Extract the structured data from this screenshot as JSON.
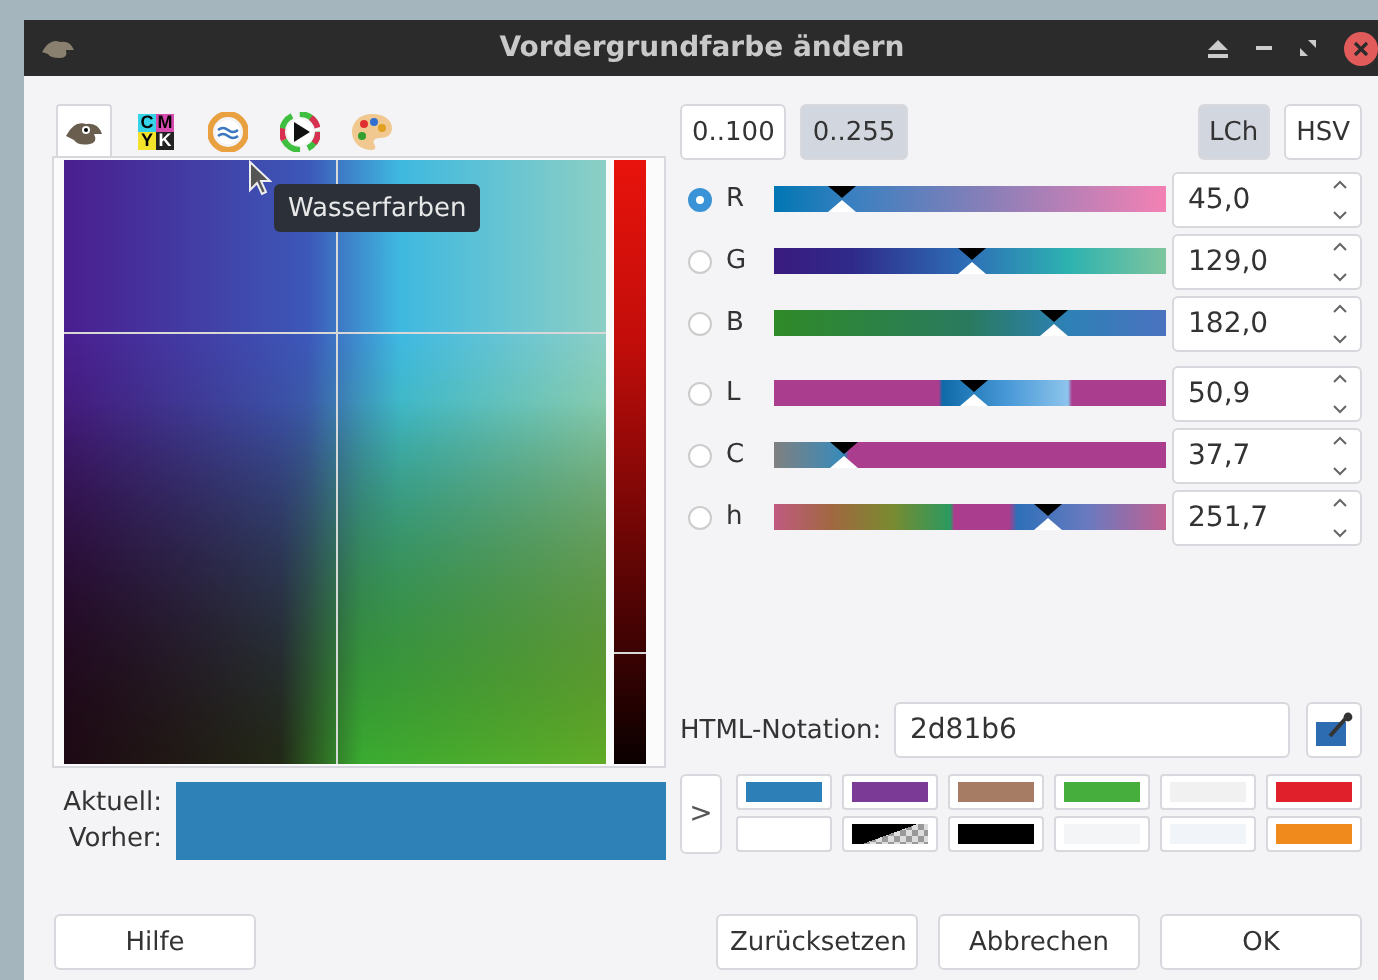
{
  "window": {
    "title": "Vordergrundfarbe ändern"
  },
  "selector_tabs": [
    {
      "kind": "gimp",
      "selected": true
    },
    {
      "kind": "cmyk",
      "selected": false,
      "letters": [
        "C",
        "M",
        "Y",
        "K"
      ]
    },
    {
      "kind": "water",
      "selected": false
    },
    {
      "kind": "wheel",
      "selected": false
    },
    {
      "kind": "palette",
      "selected": false
    }
  ],
  "tooltip": "Wasserfarben",
  "range_buttons": [
    {
      "label": "0..100",
      "selected": false
    },
    {
      "label": "0..255",
      "selected": true
    }
  ],
  "model_buttons": [
    {
      "label": "LCh",
      "selected": true
    },
    {
      "label": "HSV",
      "selected": false
    }
  ],
  "rgb_channels": [
    {
      "label": "R",
      "selected": true,
      "level": 0.176,
      "value": "45,0"
    },
    {
      "label": "G",
      "selected": false,
      "level": 0.506,
      "value": "129,0"
    },
    {
      "label": "B",
      "selected": false,
      "level": 0.714,
      "value": "182,0"
    }
  ],
  "lch_channels": [
    {
      "label": "L",
      "selected": false,
      "level": 0.509,
      "value": "50,9"
    },
    {
      "label": "C",
      "selected": false,
      "level": 0.18,
      "value": "37,7"
    },
    {
      "label": "h",
      "selected": false,
      "level": 0.699,
      "value": "251,7"
    }
  ],
  "html_notation": {
    "label": "HTML-Notation:",
    "value": "2d81b6"
  },
  "color_labels": [
    "Aktuell:",
    "Vorher:"
  ],
  "history_button": ">",
  "swatches": [
    {
      "kind": "color",
      "color": "#2d7fb7"
    },
    {
      "kind": "color",
      "color": "#7b3a96"
    },
    {
      "kind": "color",
      "color": "#a67c64"
    },
    {
      "kind": "color",
      "color": "#45ae3c"
    },
    {
      "kind": "color",
      "color": "#f1f1f1"
    },
    {
      "kind": "color",
      "color": "#e0202a"
    },
    {
      "kind": "color",
      "color": "#ffffff"
    },
    {
      "kind": "transparent",
      "color": "#000000"
    },
    {
      "kind": "color",
      "color": "#000000"
    },
    {
      "kind": "color",
      "color": "#f3f5f7"
    },
    {
      "kind": "color",
      "color": "#f1f4f8"
    },
    {
      "kind": "color",
      "color": "#f08a1c"
    }
  ],
  "buttons": [
    {
      "label": "Hilfe"
    },
    {
      "label": "Zurücksetzen"
    },
    {
      "label": "Abbrechen"
    },
    {
      "label": "OK"
    }
  ]
}
